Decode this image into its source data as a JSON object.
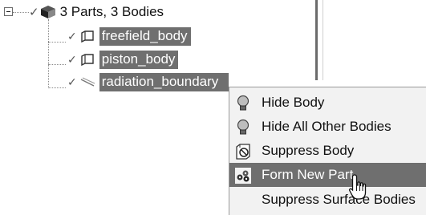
{
  "tree": {
    "root": {
      "label": "3 Parts, 3 Bodies",
      "icon": "parts-cube-icon"
    },
    "bodies": [
      {
        "label": "freefield_body",
        "icon": "solid-body-icon",
        "selected": true
      },
      {
        "label": "piston_body",
        "icon": "solid-body-icon",
        "selected": true
      },
      {
        "label": "radiation_boundary",
        "icon": "surface-body-icon",
        "selected": true
      }
    ]
  },
  "context_menu": {
    "items": [
      {
        "label": "Hide Body",
        "icon": "lightbulb-icon",
        "highlighted": false
      },
      {
        "label": "Hide All Other Bodies",
        "icon": "lightbulb-icon",
        "highlighted": false
      },
      {
        "label": "Suppress Body",
        "icon": "suppress-body-icon",
        "highlighted": false
      },
      {
        "label": "Form New Part",
        "icon": "form-new-part-icon",
        "highlighted": true
      },
      {
        "label": "Suppress Surface Bodies",
        "icon": "",
        "highlighted": false
      }
    ]
  },
  "colors": {
    "selection": "#6f6f6f",
    "menu_background": "#f2f2f2",
    "menu_highlight": "#6f6f6f"
  }
}
